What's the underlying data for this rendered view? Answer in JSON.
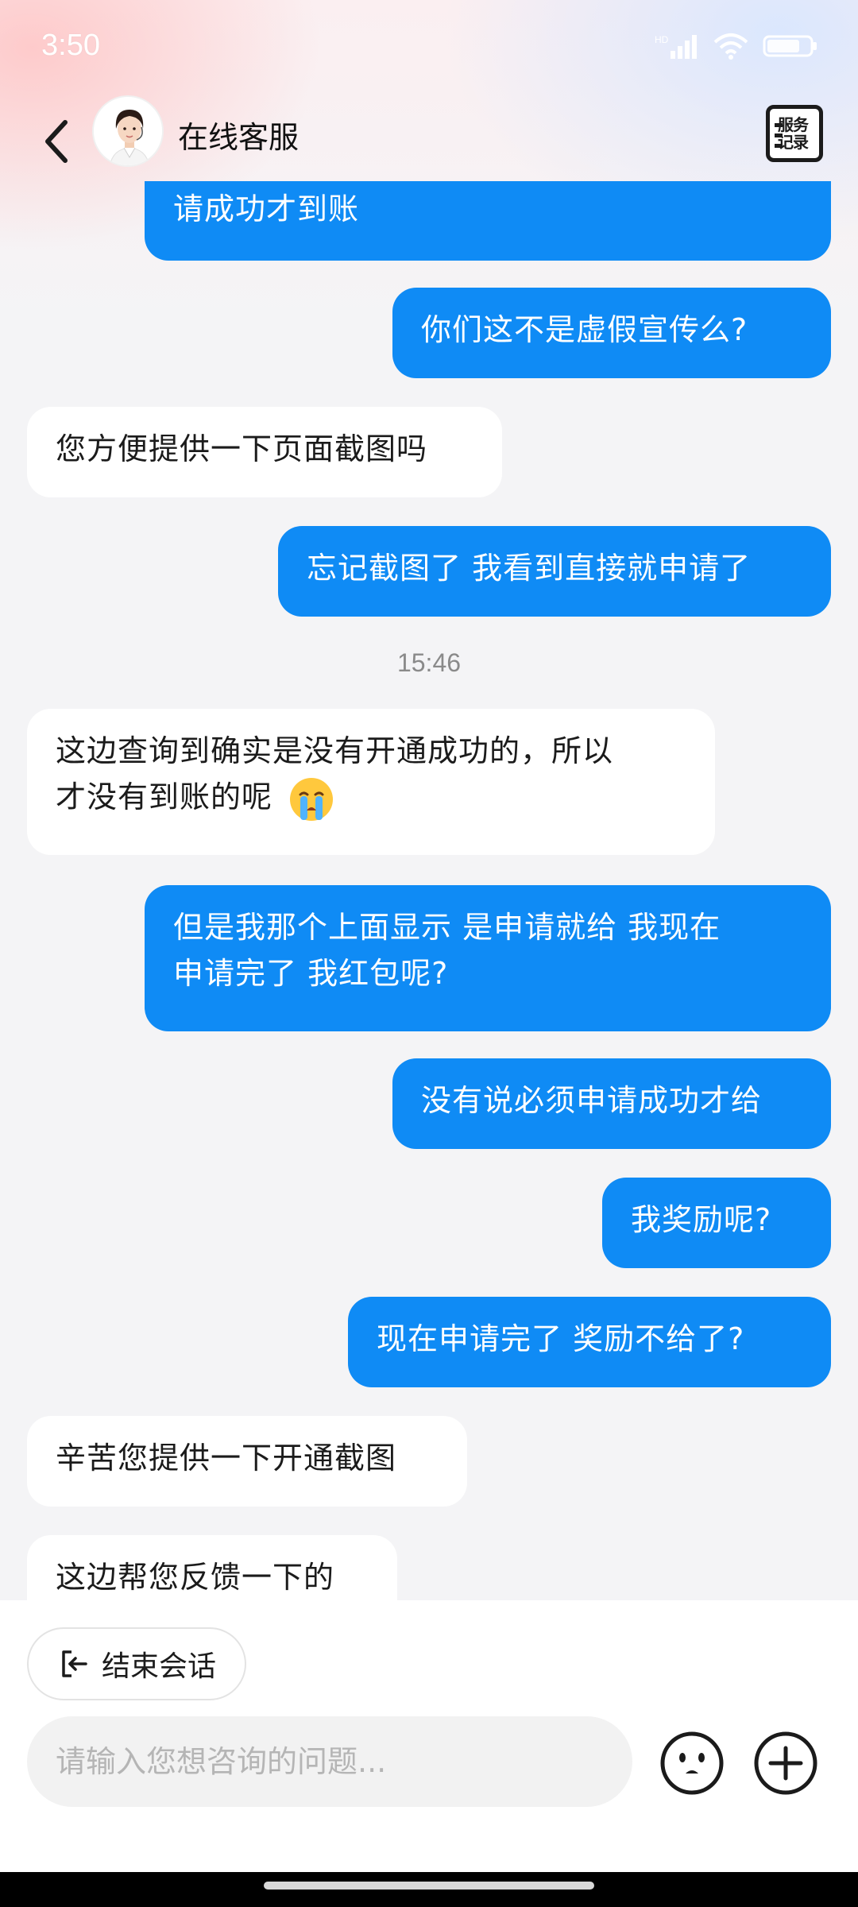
{
  "status_bar": {
    "time": "3:50",
    "icons": [
      "hd-signal-icon",
      "wifi-icon",
      "battery-icon"
    ]
  },
  "header": {
    "title": "在线客服",
    "service_record_label": "服务记录",
    "icons": {
      "back": "chevron-left-icon",
      "avatar": "agent-avatar"
    }
  },
  "messages": [
    {
      "side": "right",
      "text": "请成功才到账"
    },
    {
      "side": "right",
      "text": "你们这不是虚假宣传么?"
    },
    {
      "side": "left",
      "text": "您方便提供一下页面截图吗"
    },
    {
      "side": "right",
      "text": "忘记截图了 我看到直接就申请了"
    },
    {
      "type": "timestamp",
      "text": "15:46"
    },
    {
      "side": "left",
      "line1": "这边查询到确实是没有开通成功的，所以",
      "line2": "才没有到账的呢",
      "emoji": "crying-face-emoji"
    },
    {
      "side": "right",
      "line1": "但是我那个上面显示 是申请就给 我现在",
      "line2": "申请完了 我红包呢?"
    },
    {
      "side": "right",
      "text": "没有说必须申请成功才给"
    },
    {
      "side": "right",
      "text": "我奖励呢?"
    },
    {
      "side": "right",
      "text": "现在申请完了 奖励不给了?"
    },
    {
      "side": "left",
      "text": "辛苦您提供一下开通截图"
    },
    {
      "side": "left",
      "text": "这边帮您反馈一下的"
    }
  ],
  "bottom": {
    "end_session_label": "结束会话",
    "input_placeholder": "请输入您想咨询的问题...",
    "icons": {
      "end": "exit-icon",
      "emoji": "smiley-icon",
      "plus": "plus-circle-icon"
    }
  },
  "colors": {
    "user_bubble": "#0f8bf5",
    "agent_bubble": "#ffffff",
    "background": "#f4f4f6"
  }
}
